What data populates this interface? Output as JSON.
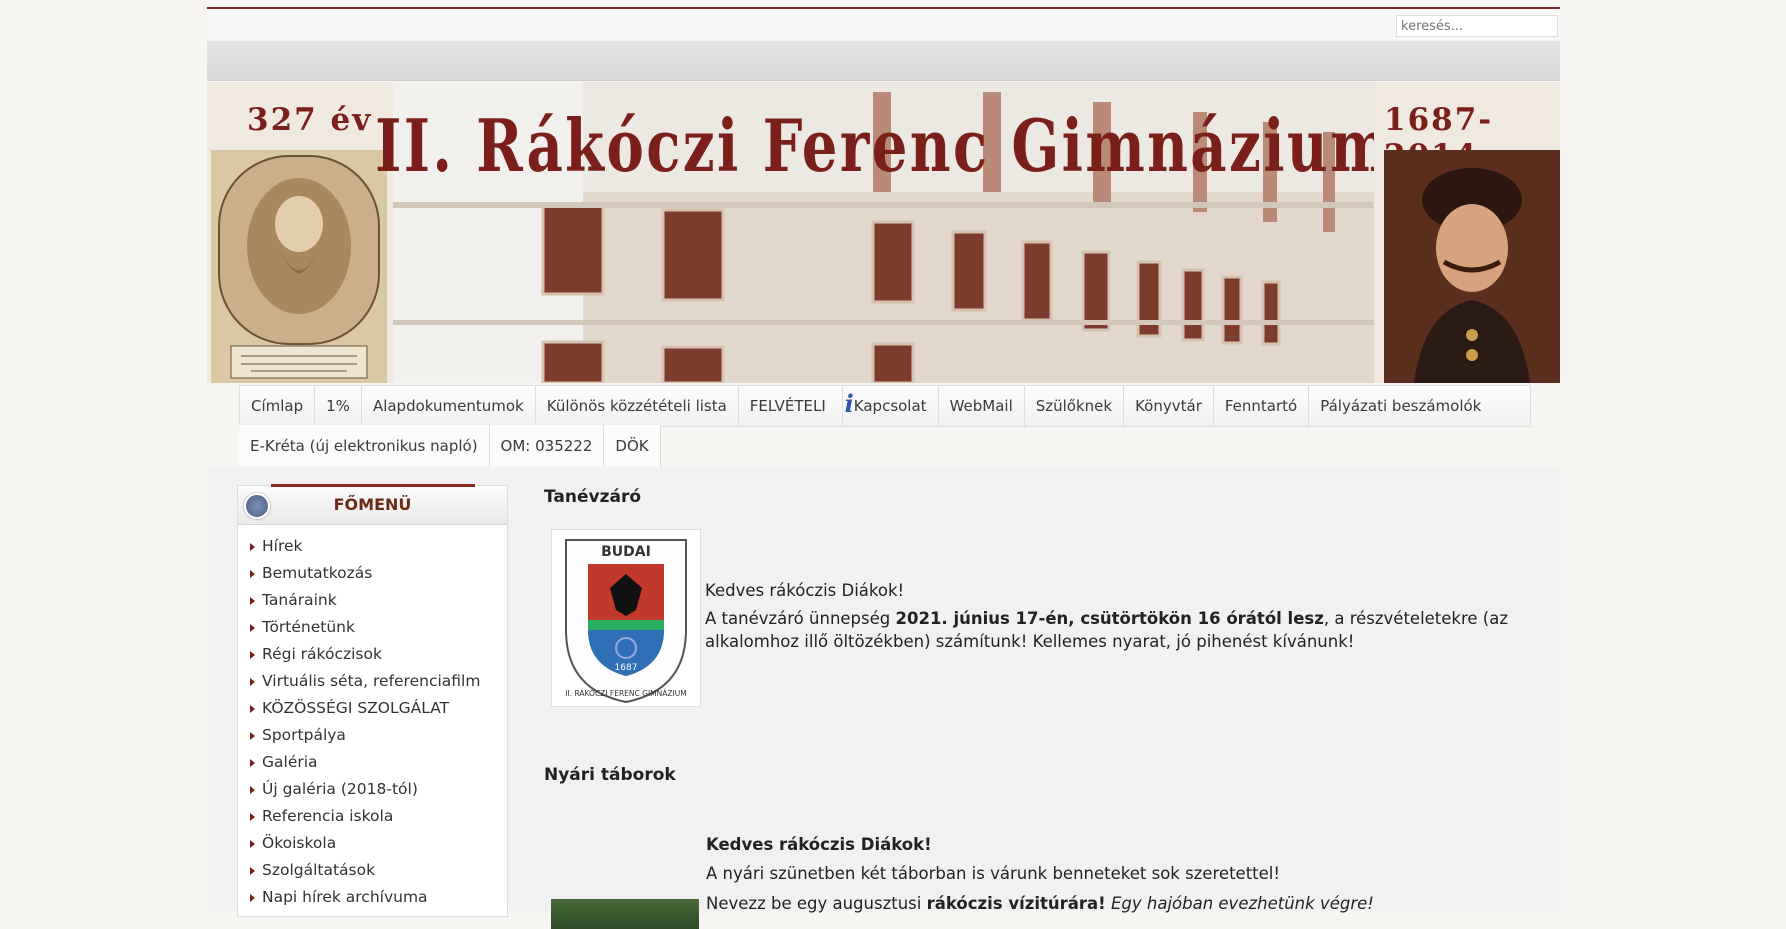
{
  "search": {
    "placeholder": "keresés..."
  },
  "banner": {
    "title": "II. Rákóczi Ferenc Gimnázium",
    "left_label": "327 év",
    "right_label": "1687-2014"
  },
  "nav": {
    "items": [
      "Címlap",
      "1%",
      "Alapdokumentumok",
      "Különös közzétételi lista",
      "FELVÉTELI",
      "Kapcsolat",
      "WebMail",
      "Szülőknek",
      "Könyvtár",
      "Fenntartó",
      "Pályázati beszámolók"
    ],
    "items2": [
      "E-Kréta (új elektronikus napló)",
      "OM: 035222",
      "DÖK"
    ]
  },
  "sidebar": {
    "title": "FŐMENÜ",
    "items": [
      "Hírek",
      "Bemutatkozás",
      "Tanáraink",
      "Történetünk",
      "Régi rákóczisok",
      "Virtuális séta, referenciafilm",
      "KÖZÖSSÉGI SZOLGÁLAT",
      "Sportpálya",
      "Galéria",
      "Új galéria (2018-tól)",
      "Referencia iskola",
      "Ökoiskola",
      "Szolgáltatások",
      "Napi hírek archívuma"
    ]
  },
  "articles": {
    "a1": {
      "title": "Tanévzáró",
      "greeting": "Kedves rákóczis Diákok!",
      "p_pre": "A tanévzáró ünnepség ",
      "p_bold": "2021. június 17-én, csütörtökön 16 órától lesz",
      "p_post": ", a részvételetekre (az alkalomhoz illő öltözékben) számítunk! Kellemes nyarat, jó pihenést kívánunk!"
    },
    "a2": {
      "title": "Nyári táborok",
      "greeting": "Kedves rákóczis Diákok!",
      "line1": "A nyári szünetben két táborban is várunk benneteket sok szeretettel!",
      "line2_pre": "Nevezz be egy augusztusi ",
      "line2_bold": "rákóczis vízitúrára!",
      "line2_italic": " Egy hajóban evezhetünk végre!"
    },
    "crest": {
      "top": "BUDAI",
      "ring": "II. RÁKÓCZI FERENC GIMNÁZIUM",
      "year": "1687"
    }
  },
  "colors": {
    "brand": "#7b1f1a",
    "accent": "#8a2a1c"
  }
}
